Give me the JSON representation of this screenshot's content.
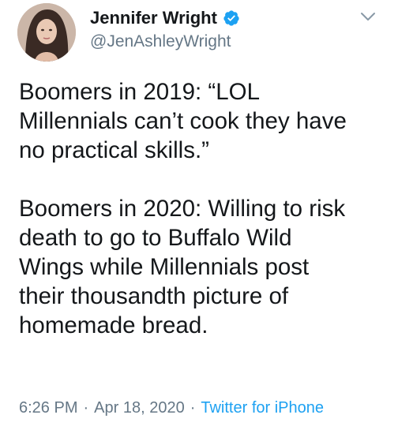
{
  "author": {
    "display_name": "Jennifer Wright",
    "handle": "@JenAshleyWright",
    "verified": true
  },
  "tweet": {
    "paragraph_1_lines": [
      "Boomers in 2019: “LOL",
      "Millennials can’t cook they have",
      "no practical skills.”"
    ],
    "paragraph_2_lines": [
      "Boomers in 2020: Willing to risk",
      "death to go to Buffalo Wild",
      "Wings while Millennials post",
      "their thousandth picture of",
      "homemade bread."
    ]
  },
  "meta": {
    "time": "6:26 PM",
    "separator": "·",
    "date": "Apr 18, 2020",
    "source": "Twitter for iPhone"
  },
  "colors": {
    "text": "#14171a",
    "secondary": "#657786",
    "accent": "#1da1f2"
  },
  "icons": {
    "verified": "verified-badge-icon",
    "menu": "chevron-down-icon"
  }
}
